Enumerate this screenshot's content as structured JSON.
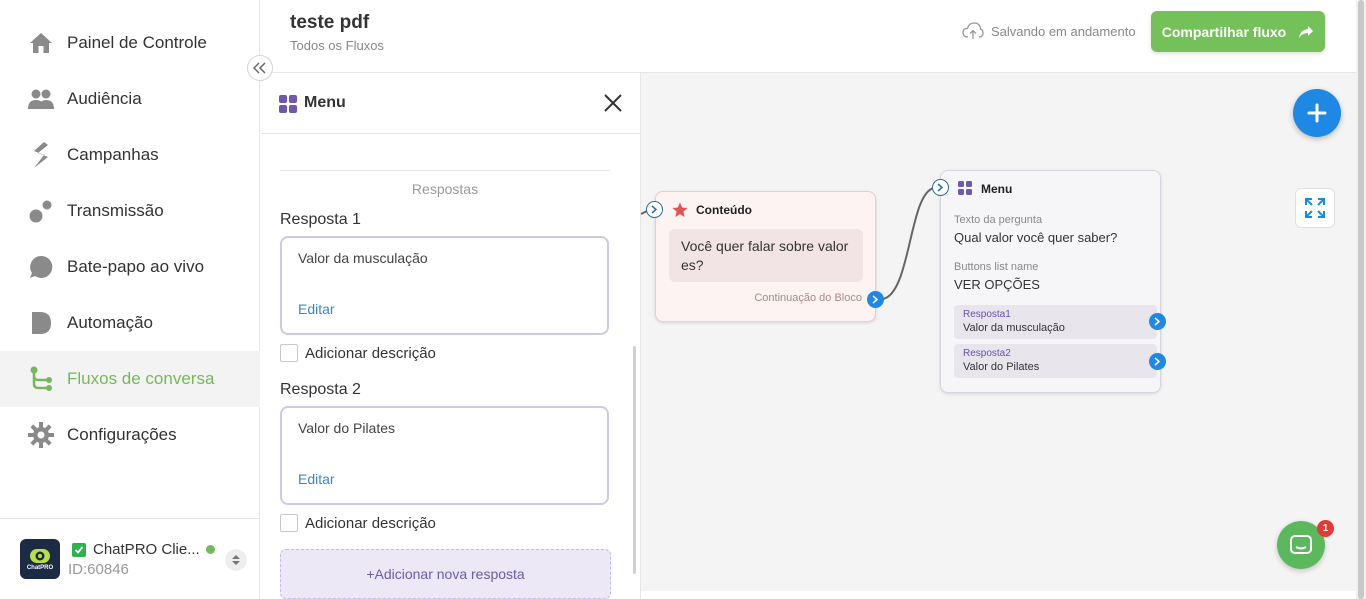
{
  "sidebar": {
    "items": [
      {
        "label": "Painel de Controle",
        "icon": "home-icon"
      },
      {
        "label": "Audiência",
        "icon": "users-icon"
      },
      {
        "label": "Campanhas",
        "icon": "campaign-icon"
      },
      {
        "label": "Transmissão",
        "icon": "broadcast-icon"
      },
      {
        "label": "Bate-papo ao vivo",
        "icon": "chat-bubble-icon"
      },
      {
        "label": "Automação",
        "icon": "automation-icon"
      },
      {
        "label": "Fluxos de conversa",
        "icon": "flow-icon",
        "active": true
      },
      {
        "label": "Configurações",
        "icon": "gear-icon"
      }
    ],
    "account": {
      "name": "ChatPRO Clie...",
      "id": "ID:60846",
      "logo_text": "ChatPRO"
    }
  },
  "header": {
    "title": "teste pdf",
    "breadcrumb": "Todos os Fluxos",
    "save_status": "Salvando em andamento",
    "share_label": "Compartilhar fluxo"
  },
  "panel": {
    "title": "Menu",
    "section_label": "Respostas",
    "responses": [
      {
        "label": "Resposta 1",
        "value": "Valor da musculação",
        "edit": "Editar",
        "description_label": "Adicionar descrição"
      },
      {
        "label": "Resposta 2",
        "value": "Valor do Pilates",
        "edit": "Editar",
        "description_label": "Adicionar descrição"
      }
    ],
    "add_response": "+Adicionar nova resposta"
  },
  "canvas": {
    "content_node": {
      "title": "Conteúdo",
      "message": "Você quer falar sobre valor es?",
      "footer": "Continuação do Bloco"
    },
    "menu_node": {
      "title": "Menu",
      "question_label": "Texto da pergunta",
      "question": "Qual valor você quer saber?",
      "list_label": "Buttons list name",
      "list_name": "VER OPÇÕES",
      "options": [
        {
          "label": "Resposta1",
          "value": "Valor da musculação"
        },
        {
          "label": "Resposta2",
          "value": "Valor do Pilates"
        }
      ]
    },
    "chat_badge": "1"
  },
  "colors": {
    "accent_green": "#74c15a",
    "active_nav": "#74b959",
    "primary_blue": "#1e88e5",
    "menu_purple": "#6f58b0",
    "content_star": "#e05555"
  }
}
